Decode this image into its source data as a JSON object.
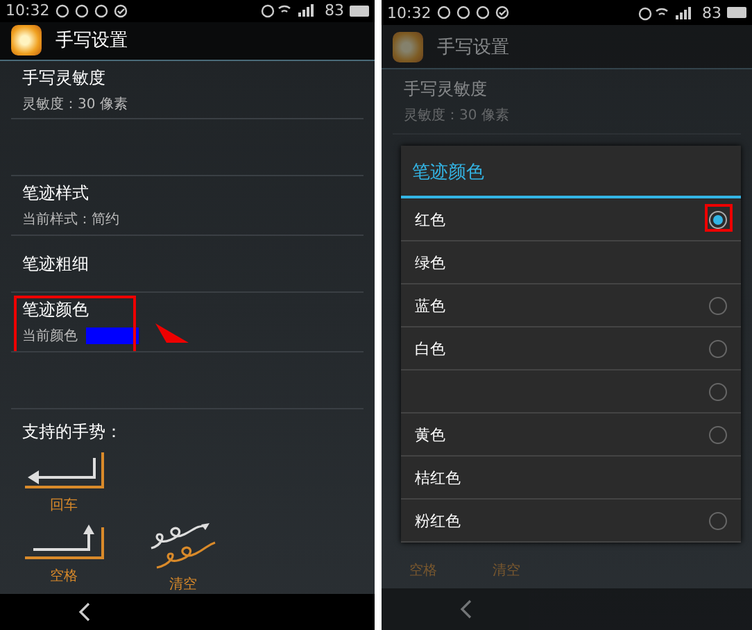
{
  "left_phone": {
    "status_bar": {
      "time": "10:32",
      "battery": "83"
    },
    "app_bar": {
      "title": "手写设置"
    },
    "settings": [
      {
        "kind": "text",
        "title": "手写灵敏度",
        "summary": "灵敏度：30 像素",
        "highlighted": false
      },
      {
        "kind": "empty",
        "highlighted": false
      },
      {
        "kind": "text",
        "title": "笔迹样式",
        "summary": "当前样式：简约",
        "highlighted": false
      },
      {
        "kind": "title",
        "title": "笔迹粗细",
        "highlighted": false
      },
      {
        "kind": "color",
        "title": "笔迹颜色",
        "summary": "当前颜色",
        "color": "#0000ff",
        "highlighted": true
      },
      {
        "kind": "empty",
        "highlighted": false
      }
    ],
    "gestures": {
      "heading": "支持的手势：",
      "rows": [
        [
          {
            "kind": "enter",
            "label": "回车"
          }
        ],
        [
          {
            "kind": "space",
            "label": "空格"
          },
          {
            "kind": "clear",
            "label": "清空"
          }
        ]
      ]
    }
  },
  "right_phone": {
    "status_bar": {
      "time": "10:32",
      "battery": "83"
    },
    "app_bar": {
      "title": "手写设置"
    },
    "first_setting": {
      "title": "手写灵敏度",
      "summary": "灵敏度：30 像素"
    },
    "dialog": {
      "title": "笔迹颜色",
      "options": [
        {
          "kind": "radio",
          "label": "红色",
          "selected": true,
          "highlighted": true
        },
        {
          "kind": "plain",
          "label": "绿色",
          "highlighted": false
        },
        {
          "kind": "radio",
          "label": "蓝色",
          "selected": false,
          "highlighted": false
        },
        {
          "kind": "radio",
          "label": "白色",
          "selected": false,
          "highlighted": false
        },
        {
          "kind": "radio",
          "selected": false,
          "highlighted": false
        },
        {
          "kind": "radio",
          "label": "黄色",
          "selected": false,
          "highlighted": false
        },
        {
          "kind": "plain",
          "label": "桔红色",
          "highlighted": false
        },
        {
          "kind": "radio",
          "label": "粉红色",
          "selected": false,
          "highlighted": false
        }
      ]
    },
    "gesture_labels": [
      "空格",
      "清空"
    ]
  }
}
